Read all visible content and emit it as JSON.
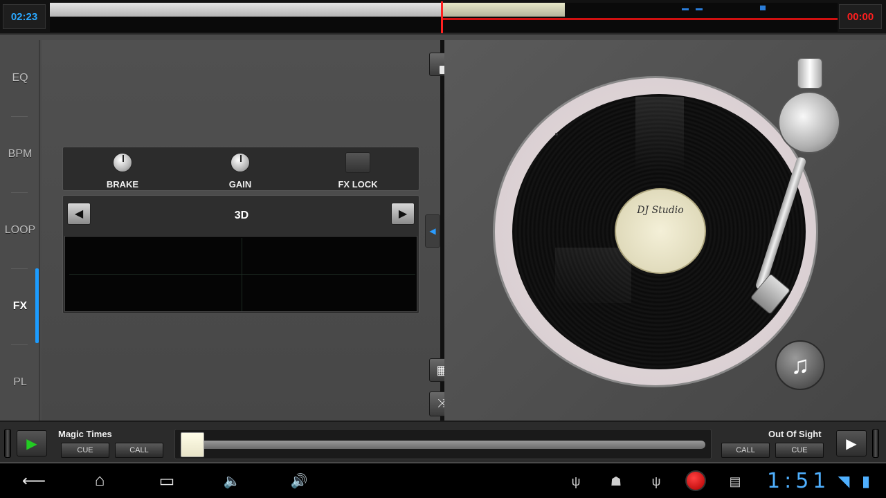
{
  "top_bar": {
    "elapsed_time": "02:23",
    "remaining_time": "00:00"
  },
  "left_menu": {
    "items": [
      {
        "label": "EQ",
        "active": false
      },
      {
        "label": "BPM",
        "active": false
      },
      {
        "label": "LOOP",
        "active": false
      },
      {
        "label": "FX",
        "active": true
      },
      {
        "label": "PL",
        "active": false
      }
    ]
  },
  "fx_panel": {
    "brake_label": "BRAKE",
    "gain_label": "GAIN",
    "fx_lock_label": "FX LOCK",
    "effect_name": "3D",
    "prev_icon": "triangle-left-icon",
    "next_icon": "triangle-right-icon"
  },
  "turntable": {
    "record_label_text": "DJ Studio",
    "add_music_icon": "music-note-plus-icon"
  },
  "deck_left": {
    "track_title": "Magic Times",
    "cue_label": "CUE",
    "call_label": "CALL",
    "play_glyph": "▶",
    "play_color": "#22cc22"
  },
  "deck_right": {
    "track_title": "Out Of Sight",
    "call_label": "CALL",
    "cue_label": "CUE",
    "play_glyph": "▶",
    "play_color": "#ffffff"
  },
  "center_controls": {
    "grid_icon": "grid-icon",
    "shuffle_icon": "shuffle-icon",
    "left_arrow_glyph": "◀",
    "right_arrow_glyph": "◀"
  },
  "system_bar": {
    "back_glyph": "⟵",
    "home_glyph": "⌂",
    "recents_glyph": "▭",
    "vol_down_glyph": "🔈",
    "vol_up_glyph": "🔊",
    "usb1_glyph": "ψ",
    "android_glyph": "☗",
    "usb2_glyph": "ψ",
    "sd_glyph": "▤",
    "time": "1:51",
    "wifi_glyph": "◥",
    "battery_glyph": "▮"
  },
  "colors": {
    "accent_blue": "#1c9cff",
    "time_left": "#2aa8ff",
    "time_right": "#ff1e1e",
    "playhead": "#ff2020",
    "clock": "#4fb0ff"
  }
}
